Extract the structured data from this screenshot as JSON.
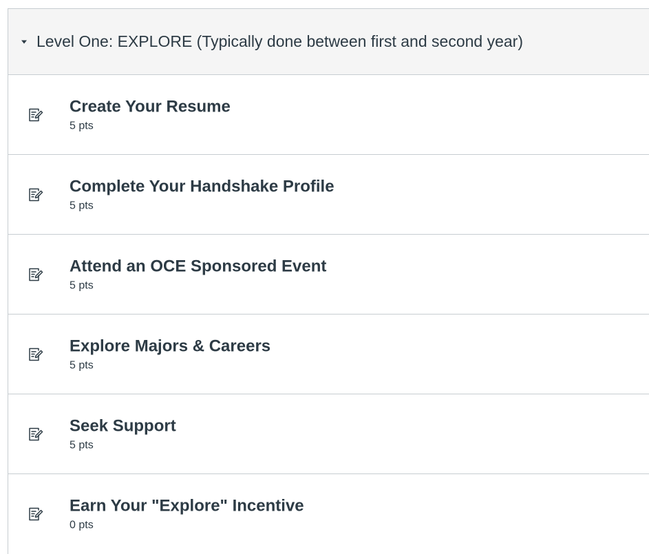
{
  "module": {
    "title": "Level One: EXPLORE (Typically done between first and second year)",
    "toggle_icon": "caret-down-icon",
    "items": [
      {
        "title": "Create Your Resume",
        "points": "5 pts",
        "icon": "assignment-icon"
      },
      {
        "title": "Complete Your Handshake Profile",
        "points": "5 pts",
        "icon": "assignment-icon"
      },
      {
        "title": "Attend an OCE Sponsored Event",
        "points": "5 pts",
        "icon": "assignment-icon"
      },
      {
        "title": "Explore Majors & Careers",
        "points": "5 pts",
        "icon": "assignment-icon"
      },
      {
        "title": "Seek Support",
        "points": "5 pts",
        "icon": "assignment-icon"
      },
      {
        "title": "Earn Your \"Explore\" Incentive",
        "points": "0 pts",
        "icon": "assignment-icon"
      }
    ]
  },
  "colors": {
    "text": "#2d3b45",
    "header_bg": "#f5f5f5",
    "border": "#c7cdd1",
    "icon": "#2d3b45"
  }
}
